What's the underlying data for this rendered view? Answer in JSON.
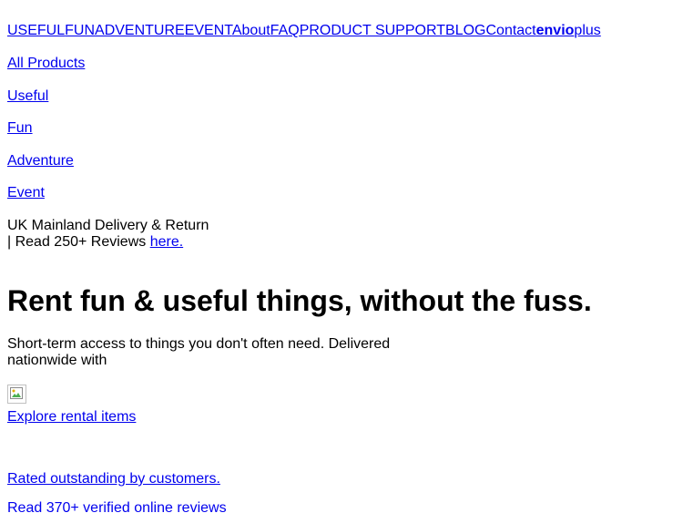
{
  "topnav": {
    "useful": "USEFUL",
    "fun": "FUN",
    "adventure": "ADVENTURE",
    "event": "EVENT",
    "about": "About",
    "faq": "FAQ",
    "product_support": "PRODUCT SUPPORT",
    "blog": "BLOG",
    "contact": "Contact",
    "envio_bold": "envio",
    "envio_plus": "plus"
  },
  "categories": {
    "all_products": "All Products",
    "useful": "Useful",
    "fun": "Fun",
    "adventure": "Adventure",
    "event": "Event"
  },
  "delivery": {
    "line1": "UK Mainland Delivery & Return",
    "line2_prefix": "| Read 250+ Reviews ",
    "link": "here."
  },
  "hero": {
    "title": "Rent fun & useful things, without the fuss.",
    "subtitle": "Short-term access to things you don't often need. Delivered nationwide with",
    "cta": "Explore rental items"
  },
  "trust": {
    "rated": "Rated outstanding by customers.",
    "reviews": "Read 370+ verified online reviews"
  },
  "colors": {
    "link": "#0000ee",
    "text": "#000000",
    "background": "#ffffff"
  }
}
